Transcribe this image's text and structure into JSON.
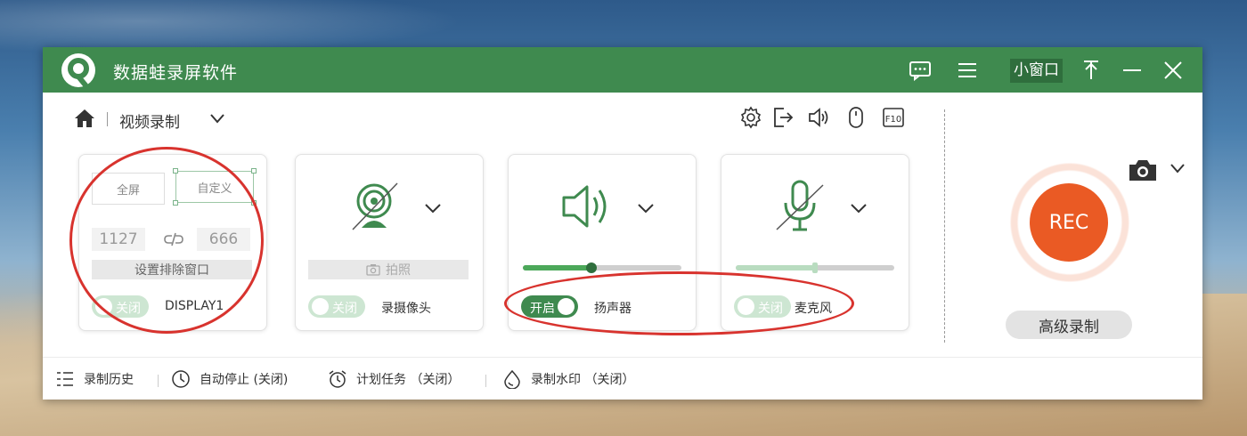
{
  "app": {
    "title": "数据蛙录屏软件"
  },
  "titlebar": {
    "mini_window_label": "小窗口",
    "icons": [
      "chat-icon",
      "menu-icon",
      "pin-icon",
      "minimize-icon",
      "close-icon"
    ]
  },
  "toolbar": {
    "mode_label": "视频录制",
    "icons": [
      "settings-icon",
      "export-icon",
      "volume-icon",
      "mouse-icon",
      "hotkey-icon"
    ]
  },
  "screen_card": {
    "full_screen_label": "全屏",
    "custom_label": "自定义",
    "width_value": "1127",
    "height_value": "666",
    "exclude_window_label": "设置排除窗口",
    "toggle_label": "关闭",
    "toggle_state": "off",
    "display_label": "DISPLAY1"
  },
  "webcam_card": {
    "photo_button_label": "拍照",
    "toggle_label": "关闭",
    "toggle_state": "off",
    "device_label": "录摄像头"
  },
  "speaker_card": {
    "volume_level": 0.43,
    "toggle_label": "开启",
    "toggle_state": "on",
    "device_label": "扬声器"
  },
  "mic_card": {
    "volume_level": 0.5,
    "toggle_label": "关闭",
    "toggle_state": "off",
    "device_label": "麦克风"
  },
  "record": {
    "rec_label": "REC",
    "advanced_label": "高级录制"
  },
  "bottom_bar": {
    "items": [
      {
        "label": "录制历史",
        "icon": "list-icon"
      },
      {
        "label": "自动停止 (关闭)",
        "icon": "clock-icon"
      },
      {
        "label": "计划任务 （关闭）",
        "icon": "alarm-icon"
      },
      {
        "label": "录制水印 （关闭）",
        "icon": "droplet-icon"
      }
    ]
  },
  "colors": {
    "brand_green": "#3f8a4f",
    "rec_orange": "#ea5a24",
    "annotation_red": "#d8332e"
  }
}
